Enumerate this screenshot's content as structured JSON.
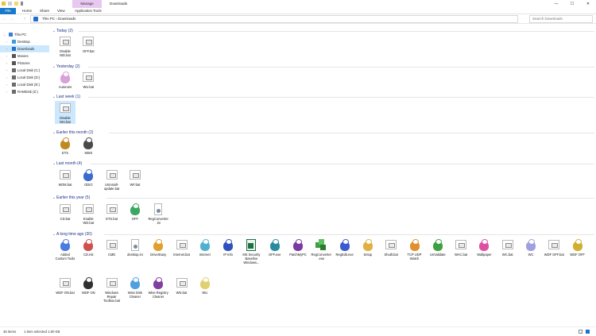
{
  "titlebar": {
    "manage_tab": "Manage",
    "window_title": "Downloads",
    "minimize": "—",
    "maximize": "☐",
    "close": "✕"
  },
  "ribbon": {
    "tabs": [
      "File",
      "Home",
      "Share",
      "View",
      "Application Tools"
    ]
  },
  "address_bar": {
    "back_icon": "←",
    "forward_icon": "→",
    "up_icon": "↑",
    "path": "This PC  ›  Downloads",
    "search_placeholder": "Search Downloads"
  },
  "sidebar": {
    "items": [
      {
        "label": "This PC",
        "icon": "computer-icon",
        "color": "#3a7bd5"
      },
      {
        "label": "Desktop",
        "icon": "folder-icon",
        "color": "#3a9be0"
      },
      {
        "label": "Downloads",
        "icon": "download-icon",
        "color": "#1f6fcf",
        "selected": true
      },
      {
        "label": "Movies",
        "icon": "folder-icon",
        "color": "#555555"
      },
      {
        "label": "Pictures",
        "icon": "folder-icon",
        "color": "#555555"
      },
      {
        "label": "Local Disk (C:)",
        "icon": "drive-icon",
        "color": "#6b6b6b"
      },
      {
        "label": "Local Disk (D:)",
        "icon": "drive-icon",
        "color": "#6b6b6b"
      },
      {
        "label": "Local Disk (E:)",
        "icon": "drive-icon",
        "color": "#6b6b6b"
      },
      {
        "label": "RAMDisk (Z:)",
        "icon": "drive-icon",
        "color": "#6b6b6b"
      }
    ]
  },
  "groups": [
    {
      "title": "Today (2)",
      "items": [
        {
          "name": "Disable WD.bat",
          "icon": "batch-file-icon"
        },
        {
          "name": "OFF.bat",
          "icon": "batch-file-icon"
        }
      ]
    },
    {
      "title": "Yesterday (2)",
      "items": [
        {
          "name": "Autoruns",
          "icon": "pony-icon",
          "color": "#d9a0d9"
        },
        {
          "name": "WU.bat",
          "icon": "batch-file-icon"
        }
      ]
    },
    {
      "title": "Last week (1)",
      "items": [
        {
          "name": "Disable WU.bat",
          "icon": "batch-file-icon",
          "selected": true
        }
      ]
    },
    {
      "title": "Earlier this month (2)",
      "items": [
        {
          "name": "ETS",
          "icon": "game-icon",
          "color": "#c08a20"
        },
        {
          "name": "MW3",
          "icon": "game-icon",
          "color": "#4a4a4a"
        }
      ]
    },
    {
      "title": "Last month (4)",
      "items": [
        {
          "name": "MOM.bat",
          "icon": "batch-file-icon"
        },
        {
          "name": "ODIO",
          "icon": "pony-icon",
          "color": "#3a6ad0"
        },
        {
          "name": "Uninstall-update.bat",
          "icon": "batch-file-icon"
        },
        {
          "name": "WF.bat",
          "icon": "batch-file-icon"
        }
      ]
    },
    {
      "title": "Earlier this year (5)",
      "items": [
        {
          "name": "CD.bat",
          "icon": "batch-file-icon"
        },
        {
          "name": "Enable WD.bat",
          "icon": "batch-file-icon"
        },
        {
          "name": "ETS.bat",
          "icon": "batch-file-icon"
        },
        {
          "name": "OFF",
          "icon": "pony-icon",
          "color": "#3aa860"
        },
        {
          "name": "RegConverter.ini",
          "icon": "ini-file-icon"
        }
      ]
    },
    {
      "title": "A long time ago (30)",
      "items": [
        {
          "name": "Added Custom Tools",
          "icon": "pony-icon",
          "color": "#4a7be0"
        },
        {
          "name": "CD.Ink",
          "icon": "pony-icon",
          "color": "#d05050"
        },
        {
          "name": "CMD",
          "icon": "batch-file-icon"
        },
        {
          "name": "desktop.ini",
          "icon": "ini-file-icon"
        },
        {
          "name": "DriverEasy",
          "icon": "pony-icon",
          "color": "#e0a030"
        },
        {
          "name": "Internet.bat",
          "icon": "batch-file-icon"
        },
        {
          "name": "Internet",
          "icon": "pony-icon",
          "color": "#50b0d0"
        },
        {
          "name": "IP Info",
          "icon": "pony-icon",
          "color": "#3050c0"
        },
        {
          "name": "MS Security Baseline Windows...",
          "icon": "excel-icon",
          "color": "#1e7145"
        },
        {
          "name": "OFF.exe",
          "icon": "pony-icon",
          "color": "#2a8aa0"
        },
        {
          "name": "PatchMyPC",
          "icon": "pony-icon",
          "color": "#7a3aa0"
        },
        {
          "name": "RegConverter.exe",
          "icon": "cubes-icon",
          "color": "#3aa040"
        },
        {
          "name": "RegEdit.exe",
          "icon": "pony-icon",
          "color": "#3a5ad0"
        },
        {
          "name": "Setup",
          "icon": "pony-icon",
          "color": "#e0b040"
        },
        {
          "name": "Shutlt.bat",
          "icon": "batch-file-icon"
        },
        {
          "name": "TCP UDP Watch",
          "icon": "pony-icon",
          "color": "#e09030"
        },
        {
          "name": "UnValidate",
          "icon": "pony-icon",
          "color": "#40a040"
        },
        {
          "name": "WAC.bat",
          "icon": "batch-file-icon"
        },
        {
          "name": "Wallpaper",
          "icon": "pony-icon",
          "color": "#e050a0"
        },
        {
          "name": "WC.bat",
          "icon": "batch-file-icon"
        },
        {
          "name": "WC",
          "icon": "pony-icon",
          "color": "#a0a0e0"
        },
        {
          "name": "WDF OFF.bat",
          "icon": "batch-file-icon"
        },
        {
          "name": "WDF OFF",
          "icon": "pony-icon",
          "color": "#d0b030"
        },
        {
          "name": "WDF ON.bat",
          "icon": "batch-file-icon"
        },
        {
          "name": "WDF ON",
          "icon": "pony-icon",
          "color": "#303030"
        },
        {
          "name": "Windows Repair Toolbox.bat",
          "icon": "batch-file-icon"
        },
        {
          "name": "Wise Disk Cleaner",
          "icon": "pony-icon",
          "color": "#50a0e0"
        },
        {
          "name": "Wise Registry Cleaner",
          "icon": "pony-icon",
          "color": "#8040a0"
        },
        {
          "name": "WN.bat",
          "icon": "batch-file-icon"
        },
        {
          "name": "WU",
          "icon": "pony-icon",
          "color": "#e0d070"
        }
      ]
    }
  ],
  "status": {
    "item_count": "46 items",
    "selection": "1 item selected  1.80 KB"
  }
}
